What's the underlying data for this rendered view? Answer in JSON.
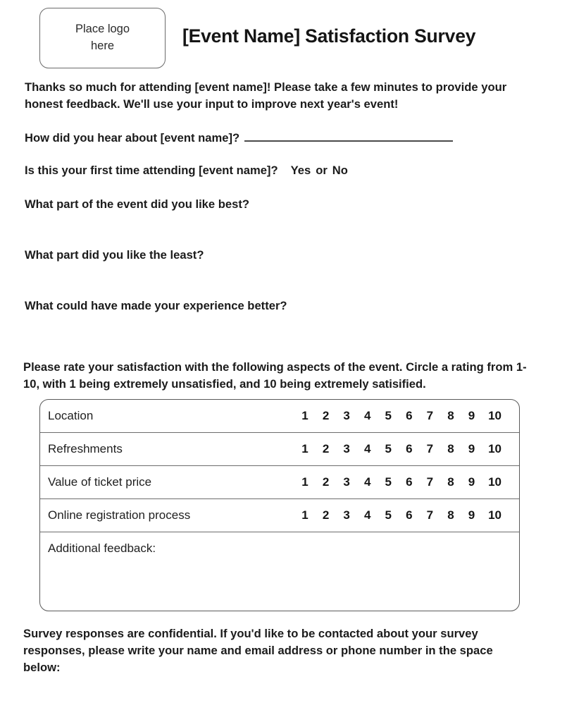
{
  "header": {
    "logo_placeholder": "Place logo\nhere",
    "title": "[Event Name] Satisfaction Survey"
  },
  "intro": {
    "text": "Thanks so much for attending [event name]! Please take a few minutes to provide your honest feedback. We'll use your input to improve next year's event!"
  },
  "questions": {
    "how_heard": {
      "label": "How did you hear about [event name]?",
      "answer_value": ""
    },
    "first_time": {
      "label": "Is this your first time attending [event name]?",
      "option_yes": "Yes",
      "separator": "or",
      "option_no": "No"
    },
    "liked_best": {
      "label": "What part of the event did you like best?",
      "answer_value": ""
    },
    "liked_least": {
      "label": "What part did you like the least?",
      "answer_value": ""
    },
    "better_experience": {
      "label": "What could have made your experience better?",
      "answer_value": ""
    }
  },
  "rating_section": {
    "instructions": "Please rate your satisfaction with the following aspects of the event. Circle a rating from 1-10, with 1 being extremely unsatisfied, and 10 being extremely satisified.",
    "scale": [
      "1",
      "2",
      "3",
      "4",
      "5",
      "6",
      "7",
      "8",
      "9",
      "10"
    ],
    "rows": [
      {
        "label": "Location"
      },
      {
        "label": "Refreshments"
      },
      {
        "label": "Value of ticket price"
      },
      {
        "label": "Online registration process"
      }
    ],
    "feedback": {
      "label": "Additional feedback:",
      "value": ""
    }
  },
  "footer": {
    "confidentiality_note": "Survey responses are confidential. If you'd like to be contacted about your survey responses, please write your name and email address or phone number in the space below:"
  },
  "colors": {
    "text": "#1b1b1b",
    "border": "#5a5a5a",
    "rule": "#4a4a4a",
    "background": "#ffffff"
  }
}
